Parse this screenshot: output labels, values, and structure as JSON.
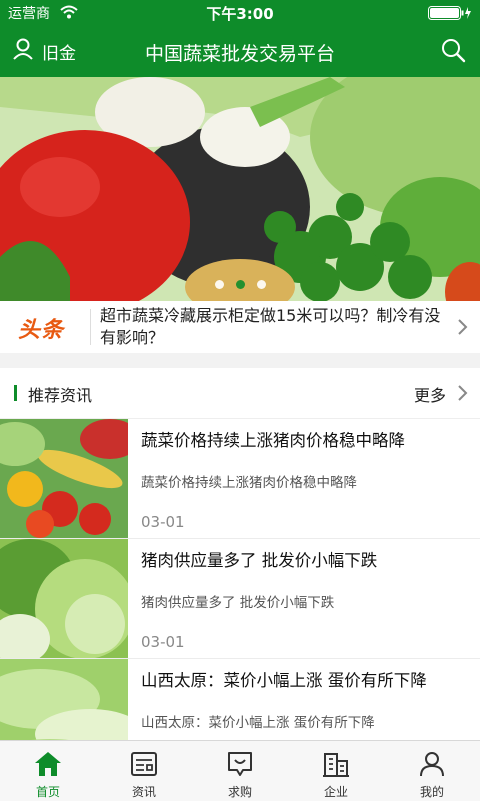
{
  "status_bar": {
    "carrier": "运营商",
    "time": "下午3:00"
  },
  "nav": {
    "location": "旧金",
    "title": "中国蔬菜批发交易平台"
  },
  "banner": {
    "slide_count": 3,
    "active_slide": 2
  },
  "headline": {
    "badge": "头条",
    "text": "超市蔬菜冷藏展示柜定做15米可以吗？制冷有没有影响？"
  },
  "section": {
    "title": "推荐资讯",
    "more": "更多"
  },
  "news": [
    {
      "title": "蔬菜价格持续上涨猪肉价格稳中略降",
      "summary": "蔬菜价格持续上涨猪肉价格稳中略降",
      "date": "03-01"
    },
    {
      "title": "猪肉供应量多了 批发价小幅下跌",
      "summary": "猪肉供应量多了 批发价小幅下跌",
      "date": "03-01"
    },
    {
      "title": "山西太原：菜价小幅上涨 蛋价有所下降",
      "summary": "山西太原：菜价小幅上涨 蛋价有所下降",
      "date": ""
    }
  ],
  "tabs": [
    {
      "label": "首页",
      "icon": "home-icon"
    },
    {
      "label": "资讯",
      "icon": "news-icon"
    },
    {
      "label": "求购",
      "icon": "purchase-icon"
    },
    {
      "label": "企业",
      "icon": "building-icon"
    },
    {
      "label": "我的",
      "icon": "user-icon"
    }
  ],
  "colors": {
    "brand": "#0e8c2a",
    "headline_badge": "#e85a12"
  }
}
